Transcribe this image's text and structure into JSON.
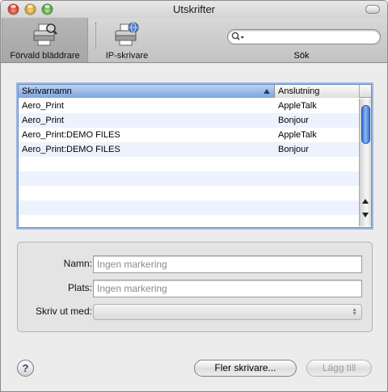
{
  "window": {
    "title": "Utskrifter"
  },
  "toolbar": {
    "items": [
      {
        "label": "Förvald bläddrare",
        "selected": true,
        "icon": "default-browser-printer-icon"
      },
      {
        "label": "IP-skrivare",
        "selected": false,
        "icon": "ip-printer-icon"
      }
    ],
    "search": {
      "label": "Sök",
      "value": "",
      "icon": "search-icon"
    }
  },
  "table": {
    "columns": [
      {
        "label": "Skrivarnamn",
        "sorted": "ascending"
      },
      {
        "label": "Anslutning"
      }
    ],
    "rows": [
      {
        "name": "Aero_Print",
        "connection": "AppleTalk"
      },
      {
        "name": "Aero_Print",
        "connection": "Bonjour"
      },
      {
        "name": "Aero_Print:DEMO FILES",
        "connection": "AppleTalk"
      },
      {
        "name": "Aero_Print:DEMO FILES",
        "connection": "Bonjour"
      }
    ]
  },
  "details": {
    "name_label": "Namn:",
    "name_placeholder": "Ingen markering",
    "location_label": "Plats:",
    "location_placeholder": "Ingen markering",
    "print_using_label": "Skriv ut med:",
    "print_using_value": ""
  },
  "buttons": {
    "help": "?",
    "more_printers": "Fler skrivare...",
    "add": "Lägg till"
  },
  "colors": {
    "selection_header": "#7fa4df",
    "alt_row": "#edf3fe",
    "disabled_text": "#a0a0a0"
  }
}
